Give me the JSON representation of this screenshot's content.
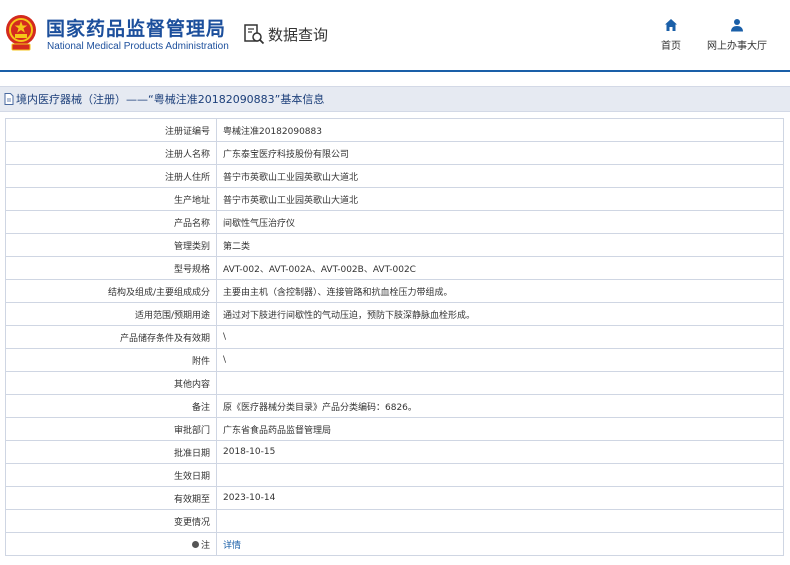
{
  "header": {
    "title": "国家药品监督管理局",
    "title_en": "National Medical Products Administration",
    "query_label": "数据查询",
    "nav": [
      {
        "label": "首页",
        "icon": "home-icon"
      },
      {
        "label": "网上办事大厅",
        "icon": "user-icon"
      }
    ]
  },
  "titlebar": {
    "text": "境内医疗器械（注册）——“粤械注准20182090883”基本信息"
  },
  "rows": [
    {
      "label": "注册证编号",
      "value": "粤械注准20182090883"
    },
    {
      "label": "注册人名称",
      "value": "广东泰宝医疗科技股份有限公司"
    },
    {
      "label": "注册人住所",
      "value": "普宁市英歌山工业园英歌山大道北"
    },
    {
      "label": "生产地址",
      "value": "普宁市英歌山工业园英歌山大道北"
    },
    {
      "label": "产品名称",
      "value": "间歇性气压治疗仪"
    },
    {
      "label": "管理类别",
      "value": "第二类"
    },
    {
      "label": "型号规格",
      "value": "AVT-002、AVT-002A、AVT-002B、AVT-002C"
    },
    {
      "label": "结构及组成/主要组成成分",
      "value": "主要由主机（含控制器）、连接管路和抗血栓压力带组成。"
    },
    {
      "label": "适用范围/预期用途",
      "value": "通过对下肢进行间歇性的气动压迫，预防下肢深静脉血栓形成。"
    },
    {
      "label": "产品储存条件及有效期",
      "value": "\\"
    },
    {
      "label": "附件",
      "value": "\\"
    },
    {
      "label": "其他内容",
      "value": ""
    },
    {
      "label": "备注",
      "value": "原《医疗器械分类目录》产品分类编码：6826。"
    },
    {
      "label": "审批部门",
      "value": "广东省食品药品监督管理局"
    },
    {
      "label": "批准日期",
      "value": "2018-10-15"
    },
    {
      "label": "生效日期",
      "value": ""
    },
    {
      "label": "有效期至",
      "value": "2023-10-14"
    },
    {
      "label": "变更情况",
      "value": ""
    },
    {
      "label": "注",
      "value": "详情"
    }
  ]
}
